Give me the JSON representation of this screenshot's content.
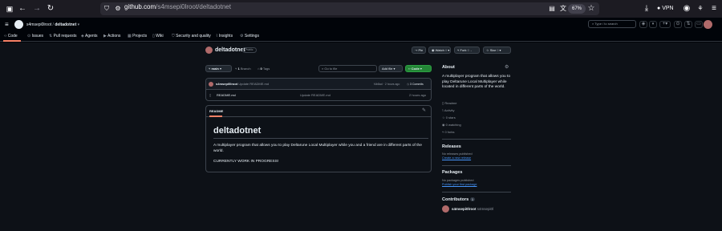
{
  "browser": {
    "url_host": "github.com",
    "url_path": "/s4msepi0lroot/deltadotnet",
    "zoom": "67%",
    "vpn_label": "VPN"
  },
  "header": {
    "owner": "s4msepi0lroot",
    "repo": "deltadotnet",
    "search_placeholder": "Type / to search",
    "tabs": [
      "Code",
      "Issues",
      "Pull requests",
      "Agents",
      "Actions",
      "Projects",
      "Wiki",
      "Security and quality",
      "Insights",
      "Settings"
    ]
  },
  "repo": {
    "name": "deltadotnet",
    "visibility": "Public",
    "pin_label": "Pin",
    "watch_label": "Watch",
    "watch_count": "0",
    "fork_label": "Fork",
    "fork_count": "0",
    "star_label": "Star",
    "star_count": "0"
  },
  "toolbar": {
    "branch": "main",
    "branch_count": "1",
    "branch_label": "Branch",
    "tag_count": "0",
    "tag_label": "Tags",
    "goto_placeholder": "Go to file",
    "add_file_label": "Add file",
    "code_label": "Code"
  },
  "commit": {
    "author": "s4msepi0lroot",
    "message": "Update README.md",
    "hash_time": "f4b8ad · 2 hours ago",
    "commits_label": "3 Commits"
  },
  "files": [
    {
      "name": "README.md",
      "message": "Update README.md",
      "time": "2 hours ago"
    }
  ],
  "readme": {
    "tab_label": "README",
    "title": "deltadotnet",
    "paragraph": "A multiplayer program that allows you to play Deltarune Local Multiplayer while you and a friend are in different parts of the world.",
    "note": "CURRENTLY WORK IN PROGRESS!"
  },
  "about": {
    "heading": "About",
    "description": "A multiplayer program that allows you to play Deltarune Local Multiplayer while located in different parts of the world.",
    "items": [
      "Readme",
      "Activity",
      "0 stars",
      "0 watching",
      "0 forks"
    ]
  },
  "releases": {
    "heading": "Releases",
    "text": "No releases published",
    "link": "Create a new release"
  },
  "packages": {
    "heading": "Packages",
    "text": "No packages published",
    "link": "Publish your first package"
  },
  "contributors": {
    "heading": "Contributors",
    "count": "1",
    "name": "s4msepi0lroot",
    "handle": "s4msepi0l"
  }
}
